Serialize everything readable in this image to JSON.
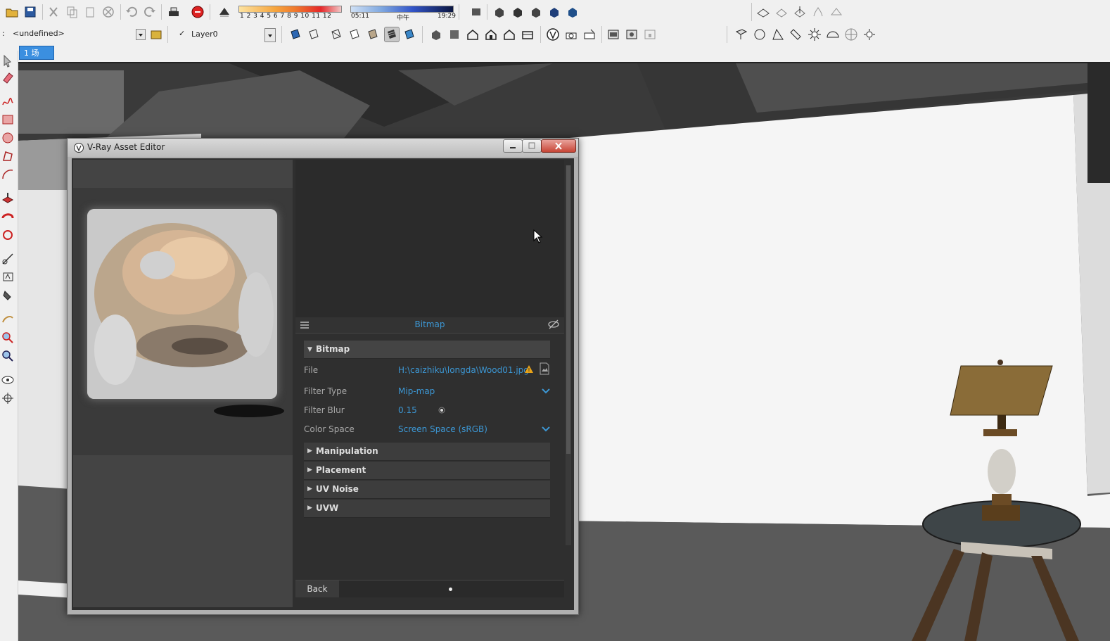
{
  "toolbar": {
    "shadow_numbers": "1 2 3 4 5 6 7 8 9 10 11 12",
    "time_start": "05:11",
    "time_mid": "中午",
    "time_end": "19:29"
  },
  "entity_bar": {
    "component_prefix": ":",
    "component_value": "<undefined>",
    "layer_check": "✓",
    "layer_value": "Layer0"
  },
  "scene_tab": {
    "label": "1 场"
  },
  "dialog": {
    "title": "V-Ray Asset Editor",
    "panel_title": "Bitmap",
    "bitmap_section": "Bitmap",
    "file_label": "File",
    "file_value": "H:\\caizhiku\\longda\\Wood01.jpg",
    "filter_type_label": "Filter Type",
    "filter_type_value": "Mip-map",
    "filter_blur_label": "Filter Blur",
    "filter_blur_value": "0.15",
    "color_space_label": "Color Space",
    "color_space_value": "Screen Space (sRGB)",
    "rollouts": [
      "Manipulation",
      "Placement",
      "UV Noise",
      "UVW"
    ],
    "back_label": "Back",
    "warning_symbol": "!"
  },
  "colors": {
    "accent_blue": "#3c97d4",
    "dialog_bg": "#2f2f2f",
    "rollout_bg": "#3d3d3d",
    "warning": "#e8a319"
  }
}
